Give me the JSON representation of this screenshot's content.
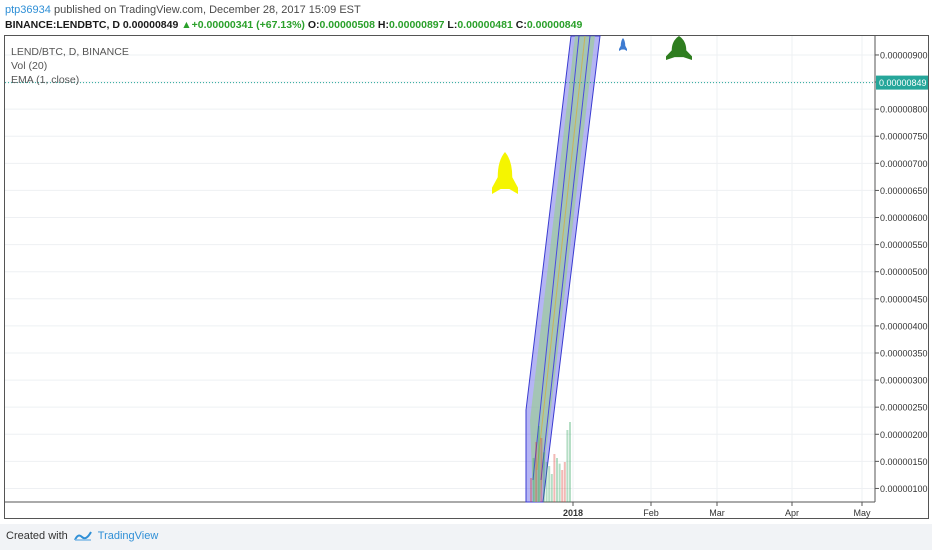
{
  "header": {
    "username": "ptp36934",
    "published": "published on TradingView.com, December 28, 2017 15:09 EST",
    "symbol": "BINANCE:LENDBTC, D",
    "last": "0.00000849",
    "change": "+0.00000341 (+67.13%)",
    "o_label": "O:",
    "o": "0.00000508",
    "h_label": "H:",
    "h": "0.00000897",
    "l_label": "L:",
    "l": "0.00000481",
    "c_label": "C:",
    "c": "0.00000849"
  },
  "legend": {
    "line1": "LEND/BTC, D, BINANCE",
    "line2": "Vol (20)",
    "line3": "EMA (1, close)"
  },
  "footer": {
    "created_with": "Created with",
    "brand": "TradingView"
  },
  "colors": {
    "up": "#2aa02a",
    "down": "#d9362b",
    "channel": "#3b3bd1",
    "last_price": "#26a69a",
    "rocket_yellow": "#f5f500",
    "rocket_blue": "#3d7bd1",
    "rocket_green": "#2e7d1f"
  },
  "chart_data": {
    "type": "candlestick",
    "ylim": [
      7.5e-07,
      9.35e-06
    ],
    "y_ticks": [
      "0.00000900",
      "0.00000850",
      "0.00000800",
      "0.00000750",
      "0.00000700",
      "0.00000650",
      "0.00000600",
      "0.00000550",
      "0.00000500",
      "0.00000450",
      "0.00000400",
      "0.00000350",
      "0.00000300",
      "0.00000250",
      "0.00000200",
      "0.00000150",
      "0.00000100"
    ],
    "x_ticks": [
      "2018",
      "Feb",
      "Mar",
      "Apr",
      "May"
    ],
    "last_price": "0.00000849",
    "candles": [
      {
        "o": 1.85,
        "h": 2.45,
        "l": 0.75,
        "c": 1.2
      },
      {
        "o": 1.2,
        "h": 1.8,
        "l": 0.95,
        "c": 1.55
      },
      {
        "o": 1.55,
        "h": 2.2,
        "l": 1.3,
        "c": 1.4
      },
      {
        "o": 1.4,
        "h": 2.6,
        "l": 1.35,
        "c": 2.4
      },
      {
        "o": 2.4,
        "h": 2.9,
        "l": 1.95,
        "c": 2.1
      },
      {
        "o": 2.1,
        "h": 3.3,
        "l": 2.05,
        "c": 3.1
      },
      {
        "o": 3.1,
        "h": 3.8,
        "l": 2.8,
        "c": 3.55
      },
      {
        "o": 3.55,
        "h": 4.4,
        "l": 3.2,
        "c": 3.75
      },
      {
        "o": 3.75,
        "h": 4.55,
        "l": 3.45,
        "c": 4.3
      },
      {
        "o": 4.3,
        "h": 4.45,
        "l": 3.7,
        "c": 3.85
      },
      {
        "o": 3.85,
        "h": 4.35,
        "l": 3.75,
        "c": 4.2
      },
      {
        "o": 4.2,
        "h": 4.75,
        "l": 4.05,
        "c": 4.5
      },
      {
        "o": 4.5,
        "h": 4.7,
        "l": 4.25,
        "c": 4.4
      },
      {
        "o": 5.8,
        "h": 5.9,
        "l": 5.0,
        "c": 5.1
      },
      {
        "o": 5.1,
        "h": 6.1,
        "l": 5.05,
        "c": 5.9
      },
      {
        "o": 5.08,
        "h": 8.97,
        "l": 4.81,
        "c": 8.49
      }
    ],
    "volumes": [
      0.3,
      0.55,
      0.75,
      0.95,
      0.8,
      0.62,
      0.5,
      0.45,
      0.35,
      0.6,
      0.55,
      0.48,
      0.4,
      0.5,
      0.9,
      1.0
    ]
  }
}
